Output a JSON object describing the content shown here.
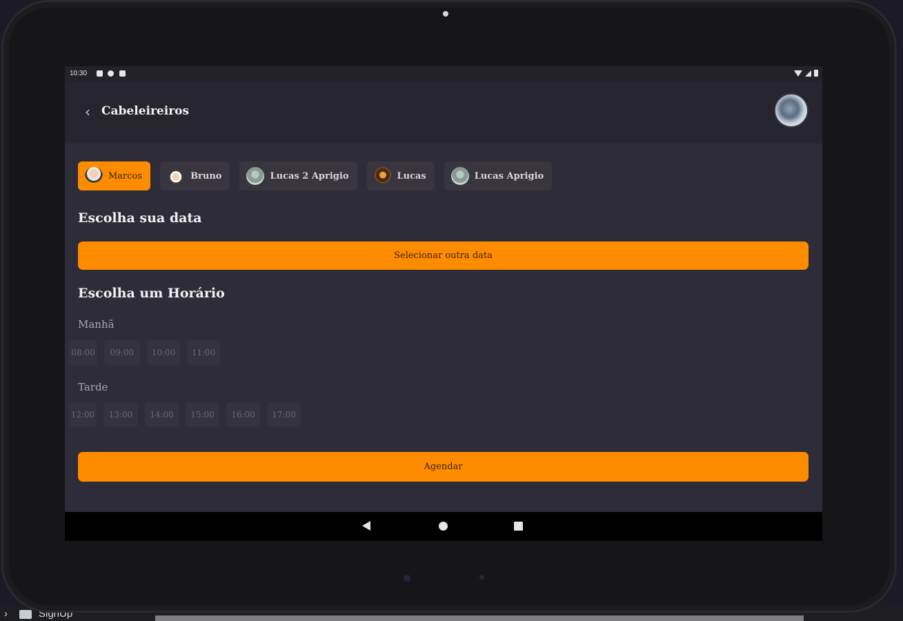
{
  "status_bar": {
    "time": "10:30"
  },
  "app_bar": {
    "title": "Cabeleireiros",
    "back_icon": "chevron-left-icon"
  },
  "barbers": [
    {
      "name": "Marcos",
      "selected": true
    },
    {
      "name": "Bruno",
      "selected": false
    },
    {
      "name": "Lucas 2 Aprigio",
      "selected": false
    },
    {
      "name": "Lucas",
      "selected": false
    },
    {
      "name": "Lucas Aprigio",
      "selected": false
    }
  ],
  "date_section": {
    "title": "Escolha sua data",
    "button_label": "Selecionar outra data"
  },
  "time_section": {
    "title": "Escolha um Horário",
    "morning": {
      "label": "Manhã",
      "slots": [
        "08:00",
        "09:00",
        "10:00",
        "11:00"
      ]
    },
    "afternoon": {
      "label": "Tarde",
      "slots": [
        "12:00",
        "13:00",
        "14:00",
        "15:00",
        "16:00",
        "17:00"
      ]
    }
  },
  "schedule_button": "Agendar",
  "desktop": {
    "folder_label": "SignUp"
  },
  "colors": {
    "accent": "#ff8c00",
    "background": "#2f2c39",
    "appbar": "#26242e"
  }
}
